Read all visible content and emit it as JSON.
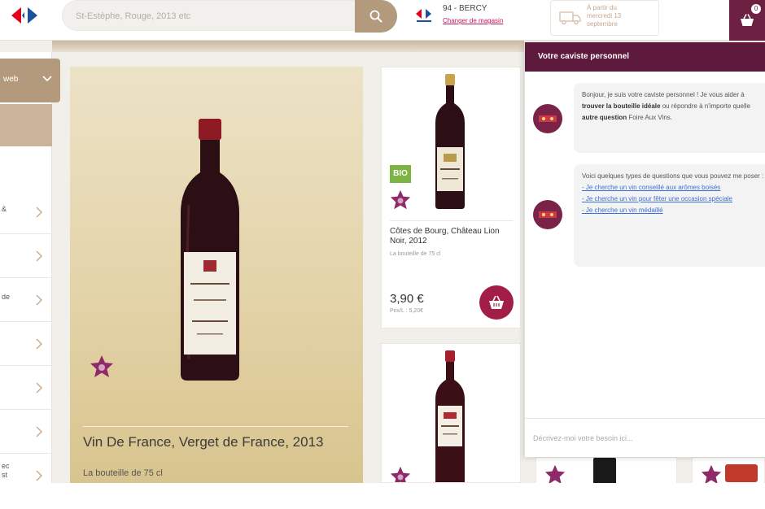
{
  "header": {
    "search_placeholder": "St-Estèphe, Rouge, 2013 etc",
    "store_name": "94 - BERCY",
    "store_link": "Changer de magasin",
    "delivery_text": "À partir du\nmercredi 13\nseptembre",
    "cart_count": "0"
  },
  "sidebar": {
    "select_label": "web",
    "items": [
      {
        "label": "&"
      },
      {
        "label": ""
      },
      {
        "label": "de"
      },
      {
        "label": ""
      },
      {
        "label": ""
      },
      {
        "label": ""
      },
      {
        "label": "ec\nst"
      }
    ]
  },
  "featured": {
    "name": "Vin De France, Verget de France, 2013",
    "size": "La bouteille de 75 cl"
  },
  "products": [
    {
      "badge": "BIO",
      "name": "Côtes de Bourg, Château Lion Noir, 2012",
      "size": "La bouteille de 75 cl",
      "price": "3,90 €",
      "unit_price": "Prix/L : 5,20€"
    }
  ],
  "chat": {
    "title": "Votre caviste personnel",
    "message1_intro": "Bonjour, je suis votre caviste personnel ! Je vous aider à ",
    "message1_bold1": "trouver la bouteille idéale",
    "message1_mid": " ou répondre à n'importe quelle ",
    "message1_bold2": "autre question",
    "message1_end": " Foire Aux Vins.",
    "message2_intro": "Voici quelques types de questions que vous pouvez me poser :",
    "links": [
      "- Je cherche un vin conseillé aux arômes boisés",
      "- Je cherche un vin pour fêter une occasion spéciale",
      "- Je cherche un vin médaillé"
    ],
    "input_placeholder": "Décrivez-moi votre besoin ici..."
  },
  "colors": {
    "brand_red": "#a31e46",
    "chat_header": "#5e1a3c",
    "accent_tan": "#b49a7c",
    "bio_green": "#7cb342"
  }
}
